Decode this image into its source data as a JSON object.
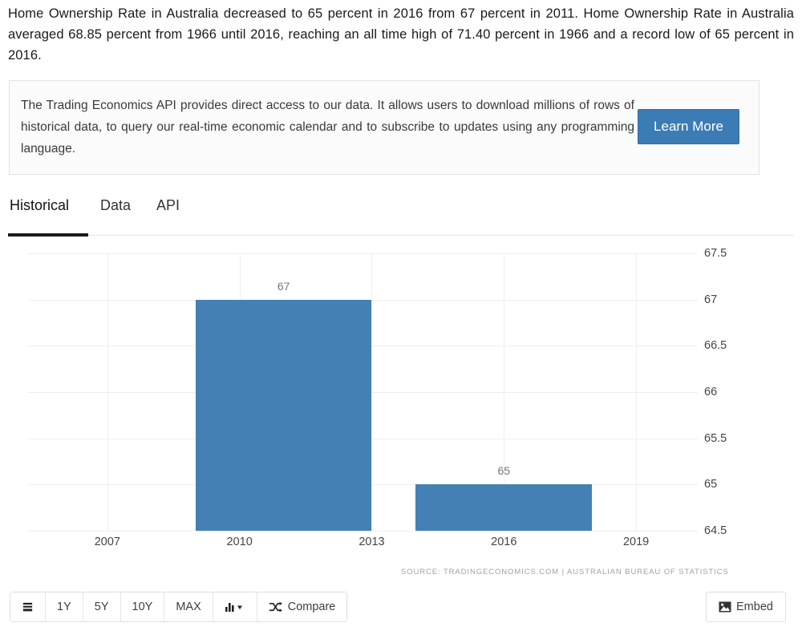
{
  "intro": {
    "paragraph": "Home Ownership Rate in Australia decreased to 65 percent in 2016 from 67 percent in 2011. Home Ownership Rate in Australia averaged 68.85 percent from 1966 until 2016, reaching an all time high of 71.40 percent in 1966 and a record low of 65 percent in 2016."
  },
  "promo": {
    "text": "The Trading Economics API provides direct access to our data. It allows users to download millions of rows of historical data, to query our real-time economic calendar and to subscribe to updates using any programming language.",
    "button_label": "Learn More",
    "button_color": "#3c7cb5"
  },
  "tabs": {
    "items": [
      {
        "label": "Historical",
        "active": true
      },
      {
        "label": "Data",
        "active": false
      },
      {
        "label": "API",
        "active": false
      }
    ]
  },
  "chart_data": {
    "type": "bar",
    "title": "",
    "xlabel": "",
    "ylabel": "",
    "categories": [
      "2011",
      "2016"
    ],
    "values": [
      67,
      65
    ],
    "data_labels": [
      "67",
      "65"
    ],
    "bar_color": "#4480b4",
    "ylim": [
      64.5,
      67.5
    ],
    "yticks": [
      "67.5",
      "67",
      "66.5",
      "66",
      "65.5",
      "65",
      "64.5"
    ],
    "ytick_values": [
      67.5,
      67,
      66.5,
      66,
      65.5,
      65,
      64.5
    ],
    "xticks": [
      "2007",
      "2010",
      "2013",
      "2016",
      "2019"
    ],
    "xtick_values": [
      2007,
      2010,
      2013,
      2016,
      2019
    ],
    "xlim": [
      2005.2,
      2020.4
    ],
    "grid": true,
    "legend": "none",
    "source": "SOURCE: TRADINGECONOMICS.COM | AUSTRALIAN BUREAU OF STATISTICS"
  },
  "toolbar": {
    "buttons": [
      {
        "label": "",
        "icon": "list-icon"
      },
      {
        "label": "1Y",
        "icon": ""
      },
      {
        "label": "5Y",
        "icon": ""
      },
      {
        "label": "10Y",
        "icon": ""
      },
      {
        "label": "MAX",
        "icon": ""
      },
      {
        "label": "",
        "icon": "bar-chart-dropdown-icon"
      },
      {
        "label": "Compare",
        "icon": "shuffle-icon"
      }
    ],
    "embed_label": "Embed"
  }
}
